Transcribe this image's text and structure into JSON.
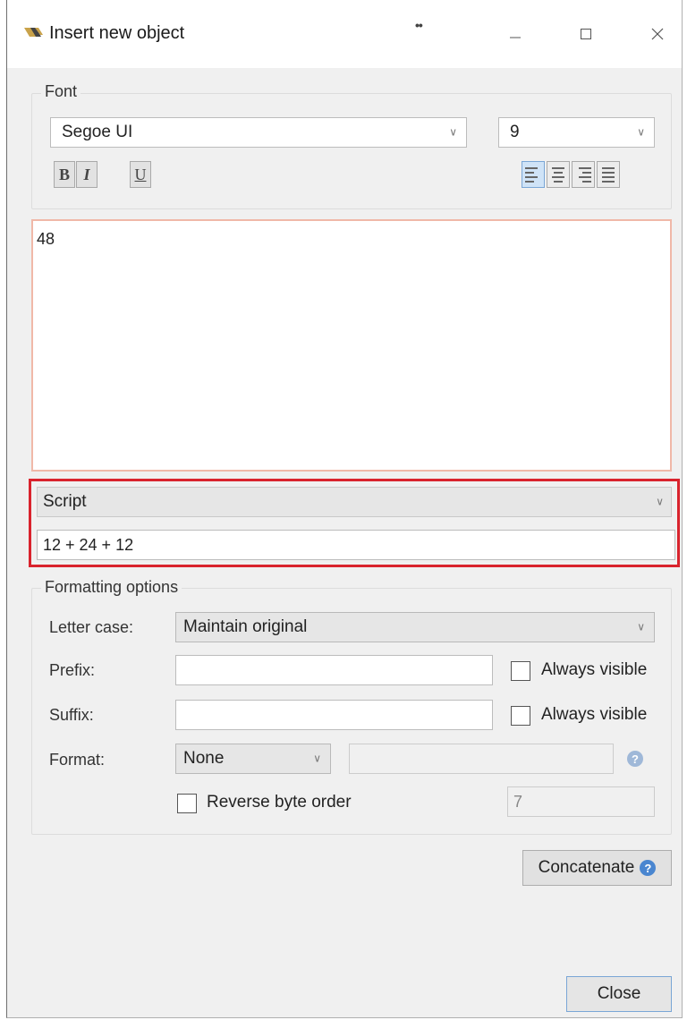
{
  "window": {
    "title": "Insert new object",
    "title_dots": "••",
    "controls": {
      "minimize_icon": "minimize-icon",
      "maximize_icon": "maximize-icon",
      "close_icon": "close-icon"
    }
  },
  "font_group": {
    "label": "Font",
    "font_family": "Segoe UI",
    "font_size": "9",
    "bold_label": "B",
    "italic_label": "I",
    "underline_label": "U",
    "alignments": [
      {
        "name": "align-left",
        "active": true
      },
      {
        "name": "align-center",
        "active": false
      },
      {
        "name": "align-right",
        "active": false
      },
      {
        "name": "align-justify",
        "active": false
      }
    ]
  },
  "content": {
    "text": "48"
  },
  "script": {
    "mode": "Script",
    "expression": "12 + 24 + 12"
  },
  "formatting": {
    "label": "Formatting options",
    "letter_case_label": "Letter case:",
    "letter_case_value": "Maintain original",
    "prefix_label": "Prefix:",
    "prefix_value": "",
    "prefix_always_visible": "Always visible",
    "suffix_label": "Suffix:",
    "suffix_value": "",
    "suffix_always_visible": "Always visible",
    "format_label": "Format:",
    "format_value": "None",
    "reverse_byte_order": "Reverse byte order",
    "byte_count": "7"
  },
  "buttons": {
    "concatenate": "Concatenate",
    "close": "Close"
  },
  "colors": {
    "highlight_border": "#d9232d",
    "help_icon": "#5b8fd0"
  }
}
